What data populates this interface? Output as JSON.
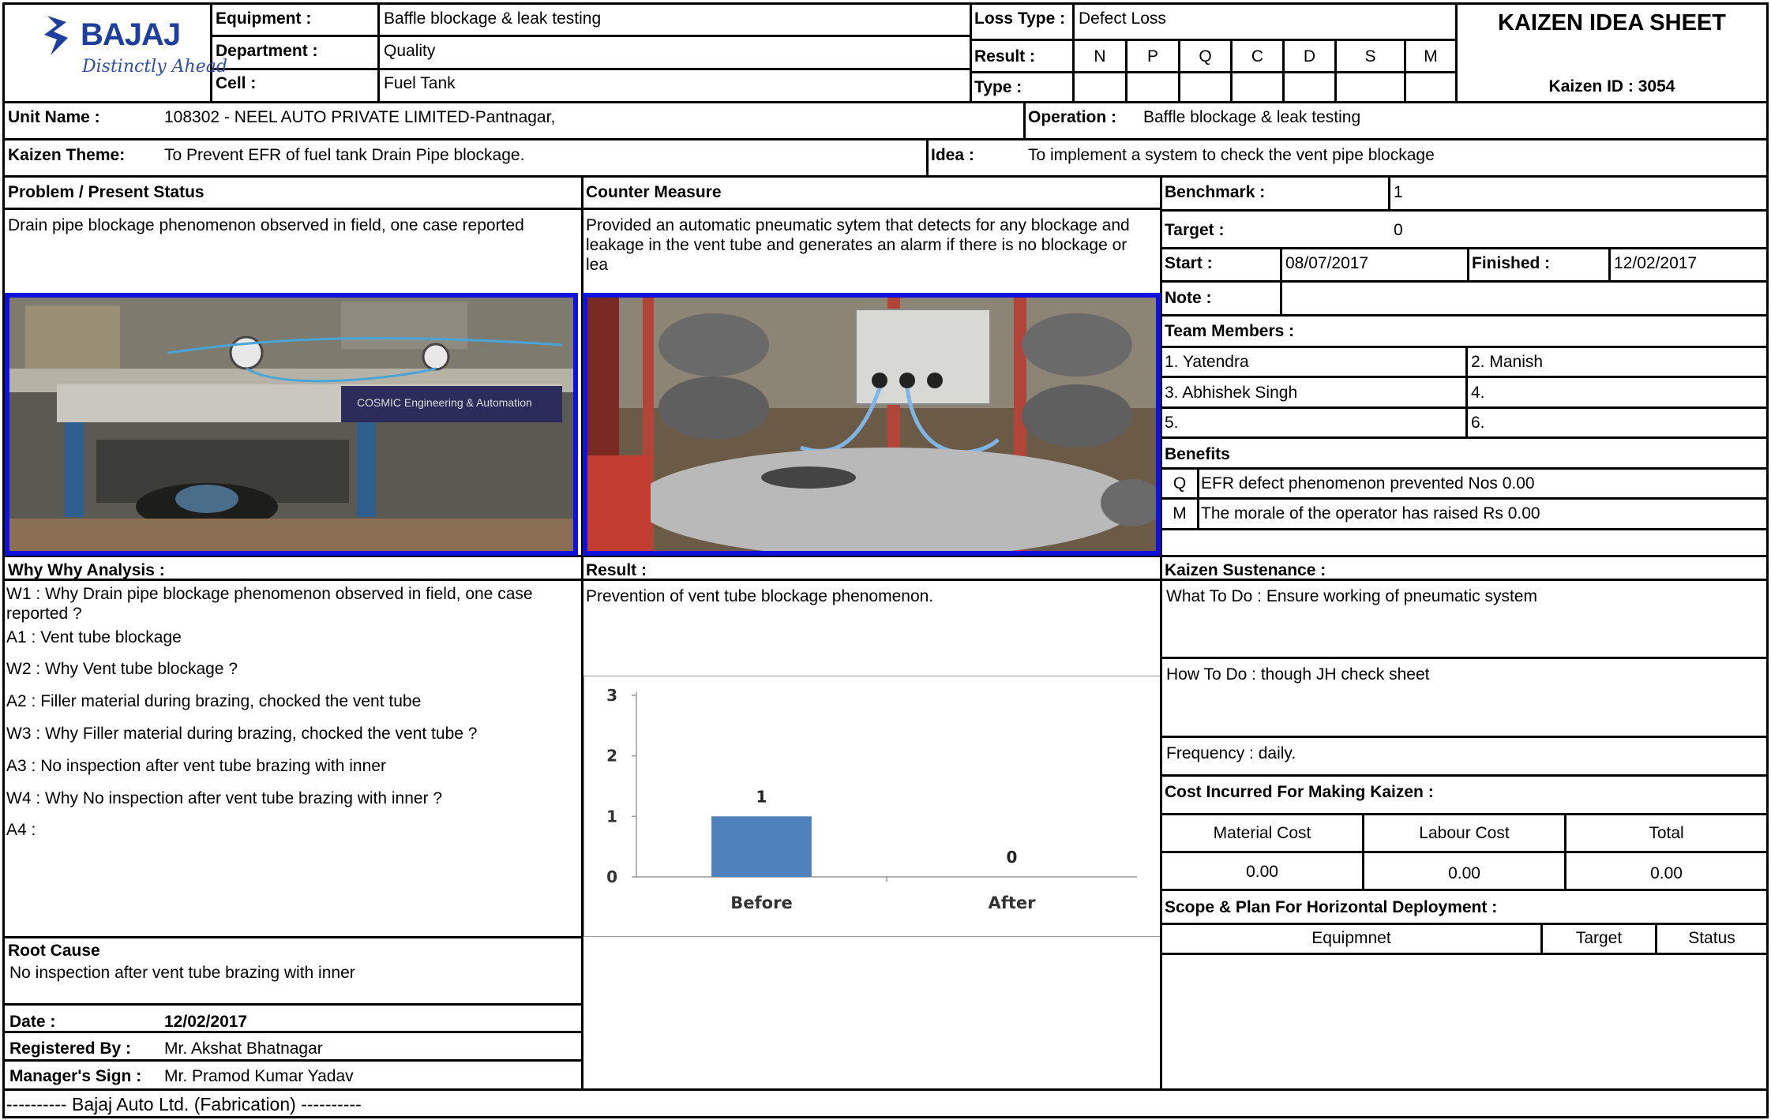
{
  "header": {
    "logo_brand": "BAJAJ",
    "logo_tagline": "Distinctly Ahead",
    "equipment_label": "Equipment :",
    "equipment": "Baffle blockage & leak testing",
    "department_label": "Department :",
    "department": "Quality",
    "cell_label": "Cell :",
    "cell": "Fuel Tank",
    "loss_type_label": "Loss Type :",
    "loss_type": "Defect Loss",
    "result_label": "Result :",
    "type_label": "Type :",
    "result_codes": [
      "N",
      "P",
      "Q",
      "C",
      "D",
      "S",
      "M"
    ],
    "sheet_title": "KAIZEN IDEA SHEET",
    "kaizen_id": "Kaizen ID : 3054"
  },
  "unit": {
    "unit_name_label": "Unit Name :",
    "unit_name": "108302 - NEEL AUTO PRIVATE LIMITED-Pantnagar,",
    "operation_label": "Operation :",
    "operation": "Baffle blockage & leak testing"
  },
  "theme": {
    "theme_label": "Kaizen Theme:",
    "theme": "To Prevent EFR of fuel tank Drain Pipe blockage.",
    "idea_label": "Idea :",
    "idea": "To implement a system to check the vent pipe blockage"
  },
  "problem": {
    "heading": "Problem / Present Status",
    "text": "Drain pipe blockage phenomenon observed in field, one case reported",
    "photo_sign_text": "COSMIC Engineering & Automation"
  },
  "counter_measure": {
    "heading": "Counter Measure",
    "text": "Provided an automatic pneumatic sytem that detects for any blockage and leakage in the vent tube and generates an alarm if there is no blockage or lea"
  },
  "details": {
    "benchmark_label": "Benchmark :",
    "benchmark": "1",
    "target_label": "Target :",
    "target": "0",
    "start_label": "Start :",
    "start": "08/07/2017",
    "finished_label": "Finished :",
    "finished": "12/02/2017",
    "note_label": "Note :",
    "note": "",
    "team_heading": "Team Members :",
    "team": [
      "1. Yatendra",
      "2. Manish",
      "3. Abhishek Singh",
      "4.",
      "5.",
      "6."
    ],
    "benefits_heading": "Benefits",
    "benefits": [
      {
        "code": "Q",
        "text": "EFR defect phenomenon prevented Nos 0.00"
      },
      {
        "code": "M",
        "text": "The morale of the operator has raised Rs 0.00"
      }
    ]
  },
  "why_why": {
    "heading": "Why Why Analysis :",
    "lines": [
      "W1 : Why Drain pipe blockage phenomenon observed in field, one case reported ?",
      "A1 : Vent tube  blockage",
      "W2 : Why Vent tube  blockage ?",
      "A2 : Filler material during brazing, chocked the vent tube",
      "W3 : Why Filler material during brazing, chocked the vent tube ?",
      "A3 : No inspection after vent tube brazing with inner",
      "W4 : Why No inspection after vent tube brazing with inner ?",
      "A4 :"
    ]
  },
  "result": {
    "heading": "Result :",
    "text": "Prevention of vent tube blockage phenomenon."
  },
  "chart_data": {
    "type": "bar",
    "categories": [
      "Before",
      "After"
    ],
    "values": [
      1,
      0
    ],
    "data_labels": [
      "1",
      "0"
    ],
    "y_ticks": [
      "0",
      "1",
      "2",
      "3"
    ],
    "ylim": [
      0,
      3
    ],
    "bar_color": "#4f81bd",
    "grid": false,
    "legend": "none"
  },
  "sustenance": {
    "heading": "Kaizen Sustenance :",
    "what": "What To Do : Ensure working of pneumatic system",
    "how": "How To Do : though JH check sheet",
    "frequency": "Frequency : daily."
  },
  "cost": {
    "heading": "Cost Incurred For Making Kaizen  :",
    "material_label": "Material Cost",
    "labour_label": "Labour Cost",
    "total_label": "Total",
    "material": "0.00",
    "labour": "0.00",
    "total": "0.00"
  },
  "scope": {
    "heading": "Scope & Plan For Horizontal Deployment :",
    "col_equipment": "Equipmnet",
    "col_target": "Target",
    "col_status": "Status"
  },
  "root_cause": {
    "heading": "Root Cause",
    "text": "No inspection after vent tube brazing with inner"
  },
  "footer": {
    "date_label": "Date :",
    "date": "12/02/2017",
    "registered_label": "Registered By :",
    "registered": "Mr. Akshat Bhatnagar",
    "manager_label": "Manager's Sign :",
    "manager": "Mr. Pramod Kumar Yadav",
    "company_line": "---------- Bajaj Auto Ltd. (Fabrication)   ----------"
  }
}
